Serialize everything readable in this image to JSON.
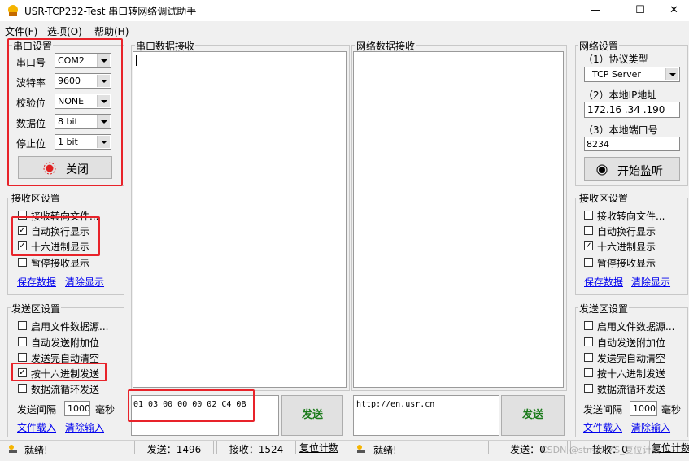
{
  "window": {
    "title": "USR-TCP232-Test 串口转网络调试助手",
    "minimize": "—",
    "maximize": "☐",
    "close": "✕"
  },
  "menu": {
    "file": "文件(F)",
    "options": "选项(O)",
    "help": "帮助(H)"
  },
  "serial_settings": {
    "title": "串口设置",
    "port_label": "串口号",
    "port_value": "COM2",
    "baud_label": "波特率",
    "baud_value": "9600",
    "parity_label": "校验位",
    "parity_value": "NONE",
    "databits_label": "数据位",
    "databits_value": "8 bit",
    "stopbits_label": "停止位",
    "stopbits_value": "1 bit",
    "close_button": "关闭"
  },
  "left_receive": {
    "title": "接收区设置",
    "options": [
      {
        "label": "接收转向文件...",
        "checked": false
      },
      {
        "label": "自动换行显示",
        "checked": true
      },
      {
        "label": "十六进制显示",
        "checked": true
      },
      {
        "label": "暂停接收显示",
        "checked": false
      }
    ],
    "save_link": "保存数据",
    "clear_link": "清除显示"
  },
  "left_send": {
    "title": "发送区设置",
    "options": [
      {
        "label": "启用文件数据源...",
        "checked": false
      },
      {
        "label": "自动发送附加位",
        "checked": false
      },
      {
        "label": "发送完自动清空",
        "checked": false
      },
      {
        "label": "按十六进制发送",
        "checked": true
      },
      {
        "label": "数据流循环发送",
        "checked": false
      }
    ],
    "interval_label": "发送间隔",
    "interval_value": "1000",
    "interval_unit": "毫秒",
    "load_link": "文件载入",
    "clear_link": "清除输入"
  },
  "serial_receive": {
    "title": "串口数据接收"
  },
  "network_receive": {
    "title": "网络数据接收"
  },
  "serial_send": {
    "input": "01 03 00 00 00 02 C4 0B",
    "send_button": "发送"
  },
  "network_send": {
    "input": "http://en.usr.cn",
    "send_button": "发送"
  },
  "network_settings": {
    "title": "网络设置",
    "protocol_label": "（1）协议类型",
    "protocol_value": "TCP Server",
    "ip_label": "（2）本地IP地址",
    "ip_value": "172.16 .34 .190",
    "port_label": "（3）本地端口号",
    "port_value": "8234",
    "listen_button": "开始监听"
  },
  "right_receive": {
    "title": "接收区设置",
    "options": [
      {
        "label": "接收转向文件...",
        "checked": false
      },
      {
        "label": "自动换行显示",
        "checked": false
      },
      {
        "label": "十六进制显示",
        "checked": true
      },
      {
        "label": "暂停接收显示",
        "checked": false
      }
    ],
    "save_link": "保存数据",
    "clear_link": "清除显示"
  },
  "right_send": {
    "title": "发送区设置",
    "options": [
      {
        "label": "启用文件数据源...",
        "checked": false
      },
      {
        "label": "自动发送附加位",
        "checked": false
      },
      {
        "label": "发送完自动清空",
        "checked": false
      },
      {
        "label": "按十六进制发送",
        "checked": false
      },
      {
        "label": "数据流循环发送",
        "checked": false
      }
    ],
    "interval_label": "发送间隔",
    "interval_value": "1000",
    "interval_unit": "毫秒",
    "load_link": "文件载入",
    "clear_link": "清除输入"
  },
  "status_left": {
    "ready": "就绪!",
    "sent": "发送：1496",
    "received": "接收：1524",
    "reset": "复位计数"
  },
  "status_right": {
    "ready": "就绪!",
    "sent": "发送：0",
    "received": "接收：0",
    "reset": "复位计数"
  },
  "watermark": "CSDN @stm32MS_复位计数"
}
